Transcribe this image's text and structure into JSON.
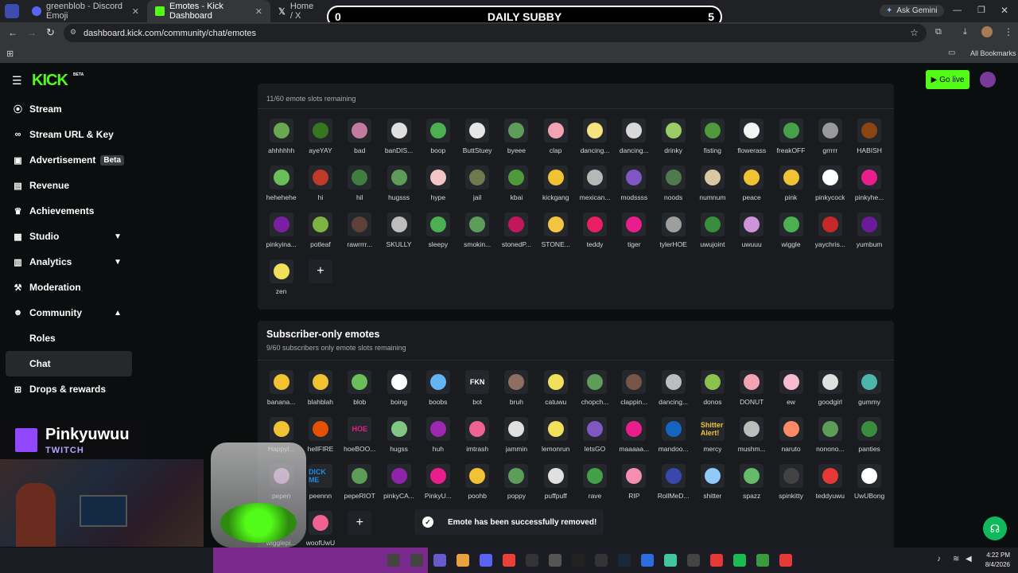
{
  "browser": {
    "tabs": [
      {
        "title": "greenblob - Discord Emoji",
        "active": false
      },
      {
        "title": "Emotes - Kick Dashboard",
        "active": true
      },
      {
        "title": "Home / X",
        "active": false
      }
    ],
    "ask_gemini": "Ask Gemini",
    "url": "dashboard.kick.com/community/chat/emotes",
    "all_bookmarks": "All Bookmarks"
  },
  "overlay": {
    "left_score": "0",
    "title": "DAILY SUBBY",
    "right_score": "5"
  },
  "topnav": {
    "logo": "KICK",
    "logo_badge": "BETA",
    "go_live": "Go live"
  },
  "sidebar": {
    "items": [
      {
        "label": "Stream",
        "icon": "broadcast-icon"
      },
      {
        "label": "Stream URL & Key",
        "icon": "link-icon"
      },
      {
        "label": "Advertisement",
        "icon": "ad-icon",
        "badge": "Beta"
      },
      {
        "label": "Revenue",
        "icon": "chart-icon"
      },
      {
        "label": "Achievements",
        "icon": "trophy-icon"
      },
      {
        "label": "Studio",
        "icon": "studio-icon",
        "chevron": "down"
      },
      {
        "label": "Analytics",
        "icon": "analytics-icon",
        "chevron": "down"
      },
      {
        "label": "Moderation",
        "icon": "hammer-icon"
      },
      {
        "label": "Community",
        "icon": "users-icon",
        "chevron": "up"
      },
      {
        "label": "Roles",
        "sub": true
      },
      {
        "label": "Chat",
        "sub": true,
        "active": true
      },
      {
        "label": "Drops & rewards",
        "icon": "gift-icon"
      }
    ]
  },
  "emotes": {
    "slots_remaining": "11/60 emote slots remaining",
    "items": [
      "ahhhhhh",
      "ayeYAY",
      "bad",
      "banDIS...",
      "boop",
      "ButtStuey",
      "byeee",
      "clap",
      "dancing...",
      "dancing...",
      "drinky",
      "fisting",
      "flowerass",
      "freakOFF",
      "grrrrr",
      "HABISH",
      "hehehehe",
      "hi",
      "hil",
      "hugsss",
      "hype",
      "jail",
      "kbai",
      "kickgang",
      "mexican...",
      "modssss",
      "noods",
      "numnum",
      "peace",
      "pink",
      "pinkycock",
      "pinkyhe...",
      "pinkyina...",
      "potleaf",
      "rawrrrr...",
      "SKULLY",
      "sleepy",
      "smokin...",
      "stonedP...",
      "STONE...",
      "teddy",
      "tiger",
      "tylerHOE",
      "uwujoint",
      "uwuuu",
      "wiggle",
      "yaychris...",
      "yumbum",
      "zen"
    ],
    "colors": [
      "#6aa84f",
      "#38761d",
      "#c27ba0",
      "#e0e0e0",
      "#4caf50",
      "#e6e6e6",
      "#5d9c59",
      "#f4a3b5",
      "#f6e27f",
      "#d9d9d9",
      "#9ccc65",
      "#4e9a3a",
      "#f4f4f4",
      "#45a047",
      "#999999",
      "#8b4513",
      "#6bbf59",
      "#c0392b",
      "#3f7d3f",
      "#5d9c59",
      "#f3c6c6",
      "#6f7a4f",
      "#4e9a3a",
      "#f1c232",
      "#b7b7b7",
      "#7e57c2",
      "#4e7a4e",
      "#d9c9a3",
      "#f1c232",
      "#f1c232",
      "#ffffff",
      "#e91e8c",
      "#7b1fa2",
      "#7cb342",
      "#5d4037",
      "#bdbdbd",
      "#4caf50",
      "#5d9c59",
      "#c2185b",
      "#f4c542",
      "#e91e63",
      "#e91e8c",
      "#9e9e9e",
      "#388e3c",
      "#ce93d8",
      "#4caf50",
      "#c62828",
      "#6a1b9a",
      "#f1e05a"
    ]
  },
  "subscriber": {
    "title": "Subscriber-only emotes",
    "slots_remaining": "9/60 subscribers only emote slots remaining",
    "items": [
      "banana...",
      "blahblah",
      "blob",
      "boing",
      "boobs",
      "bot",
      "bruh",
      "catuwu",
      "chopch...",
      "clappin...",
      "dancing...",
      "donos",
      "DONUT",
      "ew",
      "goodgirl",
      "gummy",
      "Happyl...",
      "hellFIRE",
      "hoeBOO...",
      "hugss",
      "huh",
      "imtrash",
      "jammin",
      "lemonrun",
      "letsGO",
      "maaaaa...",
      "mandoo...",
      "mercy",
      "mushm...",
      "naruto",
      "nonono...",
      "panties",
      "pepen",
      "peennn",
      "pepeRIOT",
      "pinkyCA...",
      "PinkyU...",
      "poohb",
      "poppy",
      "puffpuff",
      "rave",
      "RIP",
      "RollMeD...",
      "shitter",
      "spazz",
      "spinkitty",
      "teddyuwu",
      "UwUBong",
      "wigglepi...",
      "woofUwU"
    ],
    "colors": [
      "#f1c232",
      "#f1c232",
      "#6bbf59",
      "#ffffff",
      "#64b5f6",
      "#111111",
      "#8d6e63",
      "#f1e05a",
      "#5d9c59",
      "#795548",
      "#bdbdbd",
      "#8bc34a",
      "#f4a3b5",
      "#f8bbd0",
      "#e0e0e0",
      "#4db6ac",
      "#f1c232",
      "#e65100",
      "#e91e8c",
      "#81c784",
      "#9c27b0",
      "#f06292",
      "#e0e0e0",
      "#f1e05a",
      "#7e57c2",
      "#e91e8c",
      "#1565c0",
      "#f1c232",
      "#bdbdbd",
      "#ff8a65",
      "#5d9c59",
      "#388e3c",
      "#ce93d8",
      "#1e88e5",
      "#5d9c59",
      "#8e24aa",
      "#e91e8c",
      "#f1c232",
      "#5d9c59",
      "#e0e0e0",
      "#43a047",
      "#f48fb1",
      "#3949ab",
      "#90caf9",
      "#66bb6a",
      "#424242",
      "#e53935",
      "#ffffff",
      "#e91e8c",
      "#f06292"
    ],
    "texts": {
      "bot": "FKN",
      "hoeBOO...": "HOE",
      "peennn": "DICK ME",
      "mercy": "Shitter Alert!"
    }
  },
  "toast": {
    "message": "Emote has been successfully removed!"
  },
  "stream": {
    "channel": "Pinkyuwuu",
    "platform": "TWITCH"
  },
  "taskbar": {
    "time": "4:22 PM",
    "date": "8/4/2026"
  }
}
